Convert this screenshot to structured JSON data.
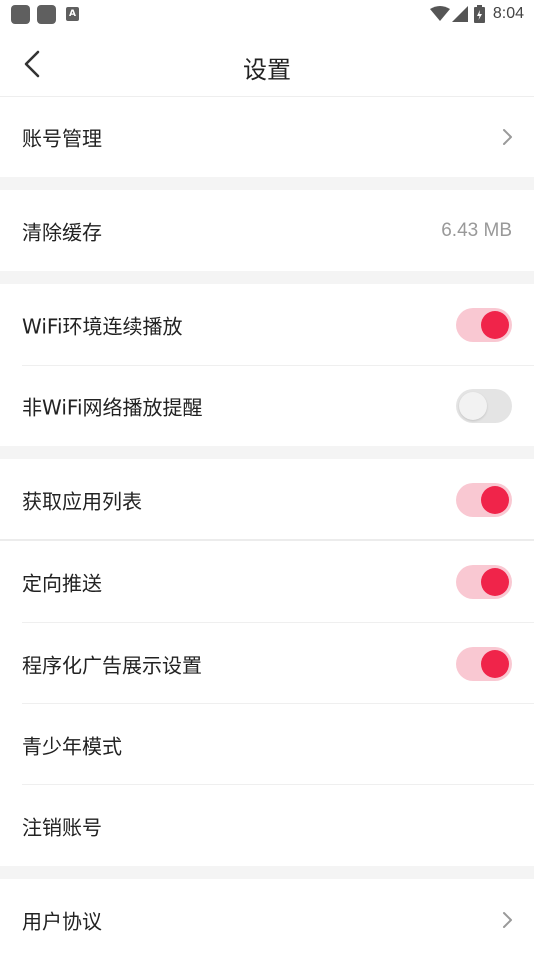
{
  "status_bar": {
    "time": "8:04",
    "notification_icons": [
      "app-icon",
      "app-icon",
      "a-icon"
    ],
    "a_icon_letter": "A",
    "indicators": [
      "wifi-icon",
      "cellular-signal-icon",
      "battery-icon"
    ]
  },
  "header": {
    "title": "设置",
    "back_icon": "chevron-left-icon"
  },
  "settings": {
    "account": {
      "label": "账号管理"
    },
    "clear_cache": {
      "label": "清除缓存",
      "value": "6.43 MB"
    },
    "wifi_autoplay": {
      "label": "WiFi环境连续播放",
      "enabled": true
    },
    "non_wifi_reminder": {
      "label": "非WiFi网络播放提醒",
      "enabled": false
    },
    "app_list": {
      "label": "获取应用列表",
      "enabled": true
    },
    "targeted_push": {
      "label": "定向推送",
      "enabled": true
    },
    "programmatic_ads": {
      "label": "程序化广告展示设置",
      "enabled": true
    },
    "teen_mode": {
      "label": "青少年模式"
    },
    "deactivate": {
      "label": "注销账号"
    },
    "user_agreement": {
      "label": "用户协议"
    }
  },
  "colors": {
    "toggle_on": "#f0244a",
    "toggle_on_track": "#f9c8d2",
    "toggle_off_track": "#e4e4e4",
    "section_gap": "#f4f4f4"
  }
}
